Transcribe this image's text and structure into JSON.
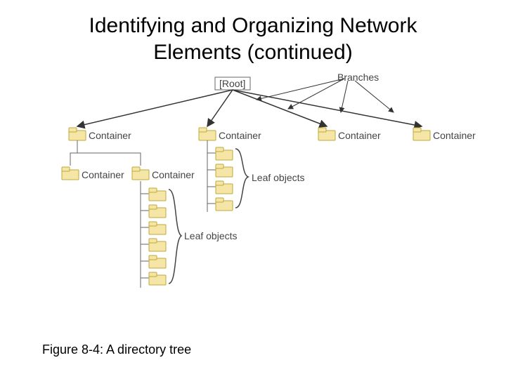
{
  "title_line1": "Identifying and Organizing Network",
  "title_line2": "Elements (continued)",
  "caption": "Figure 8-4: A directory tree",
  "labels": {
    "root": "[Root]",
    "branches": "Branches",
    "container": "Container",
    "leaf_objects": "Leaf objects"
  },
  "colors": {
    "folder_fill": "#f5e6a8",
    "folder_stroke": "#bfa93a"
  },
  "chart_data": {
    "type": "tree",
    "root": "[Root]",
    "branch_label": "Branches",
    "level1_children": [
      "Container",
      "Container",
      "Container",
      "Container"
    ],
    "level1_container1_children": {
      "sub_containers": [
        "Container",
        "Container"
      ],
      "container2_leaf_count": 6,
      "leaf_label": "Leaf objects"
    },
    "level1_container2_children": {
      "leaf_count": 4,
      "leaf_label": "Leaf objects"
    }
  }
}
